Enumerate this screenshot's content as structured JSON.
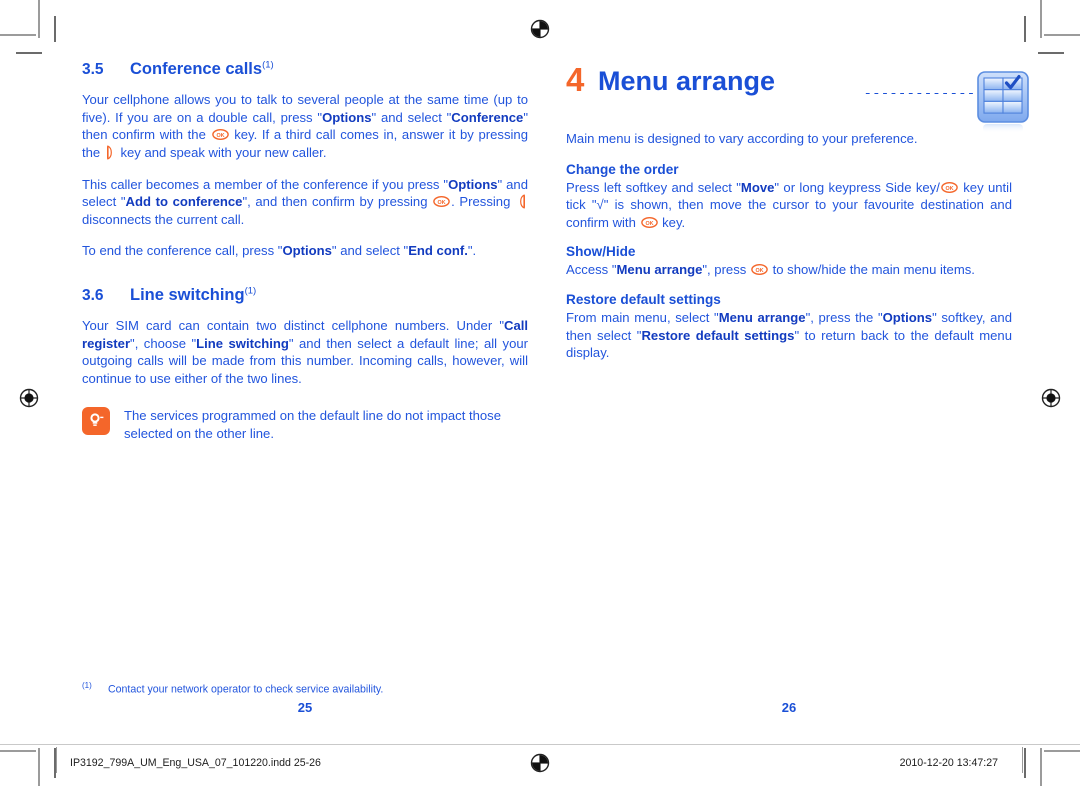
{
  "document": {
    "left_page": {
      "sections": [
        {
          "number": "3.5",
          "title": "Conference calls",
          "footnote_mark": "(1)",
          "paragraphs": [
            "Your cellphone allows you to talk to several people at the same time (up to five). If you are on a double call, press \"Options\" and select \"Conference\" then confirm with the [OK] key. If a third call comes in, answer it by pressing the [pickup] key and speak with your new caller.",
            "This caller becomes a member of the conference if you press \"Options\" and select \"Add to conference\", and then confirm by pressing [OK]. Pressing [hangup] disconnects the current call.",
            "To end the conference call, press \"Options\" and select \"End conf.\"."
          ]
        },
        {
          "number": "3.6",
          "title": "Line switching",
          "footnote_mark": "(1)",
          "paragraphs": [
            "Your SIM card can contain two distinct cellphone numbers. Under \"Call register\", choose \"Line switching\" and then select a default line; all your outgoing calls will be made from this number. Incoming calls, however, will continue to use either of the two lines."
          ]
        }
      ],
      "tip": {
        "icon": "lightbulb-icon",
        "text": "The services programmed on the default line do not impact those selected on the other line."
      },
      "footnote": {
        "mark": "(1)",
        "text": "Contact your network operator to check service availability."
      },
      "page_number": "25"
    },
    "right_page": {
      "chapter": {
        "number": "4",
        "title": "Menu arrange",
        "leader_dots": "................",
        "icon": "menu-grid-check-icon"
      },
      "intro": "Main menu is designed to vary according to your preference.",
      "blocks": [
        {
          "heading": "Change the order",
          "text": "Press left softkey and select \"Move\" or long keypress Side key/[OK] key until tick \"√\" is shown, then move the cursor to your favourite destination and confirm with [OK] key."
        },
        {
          "heading": "Show/Hide",
          "text": "Access \"Menu arrange\", press [OK] to show/hide the main menu items."
        },
        {
          "heading": "Restore default settings",
          "text": "From main menu, select \"Menu arrange\", press the \"Options\" softkey, and then select \"Restore default settings\" to return back to the default menu display."
        }
      ],
      "page_number": "26"
    },
    "print_bar": {
      "file_name": "IP3192_799A_UM_Eng_USA_07_101220.indd   25-26",
      "timestamp": "2010-12-20   13:47:27"
    },
    "colors": {
      "heading_blue": "#1a4fd6",
      "body_blue": "#2255dd",
      "accent_orange": "#f4662a",
      "icon_blue": "#3a6fd8"
    },
    "inline_labels": {
      "ok_key": "OK",
      "options": "Options",
      "conference": "Conference",
      "add_to_conference": "Add to conference",
      "end_conf": "End conf.",
      "call_register": "Call register",
      "line_switching": "Line switching",
      "move": "Move",
      "menu_arrange": "Menu arrange",
      "restore_default_settings": "Restore default settings",
      "tick": "√"
    }
  }
}
